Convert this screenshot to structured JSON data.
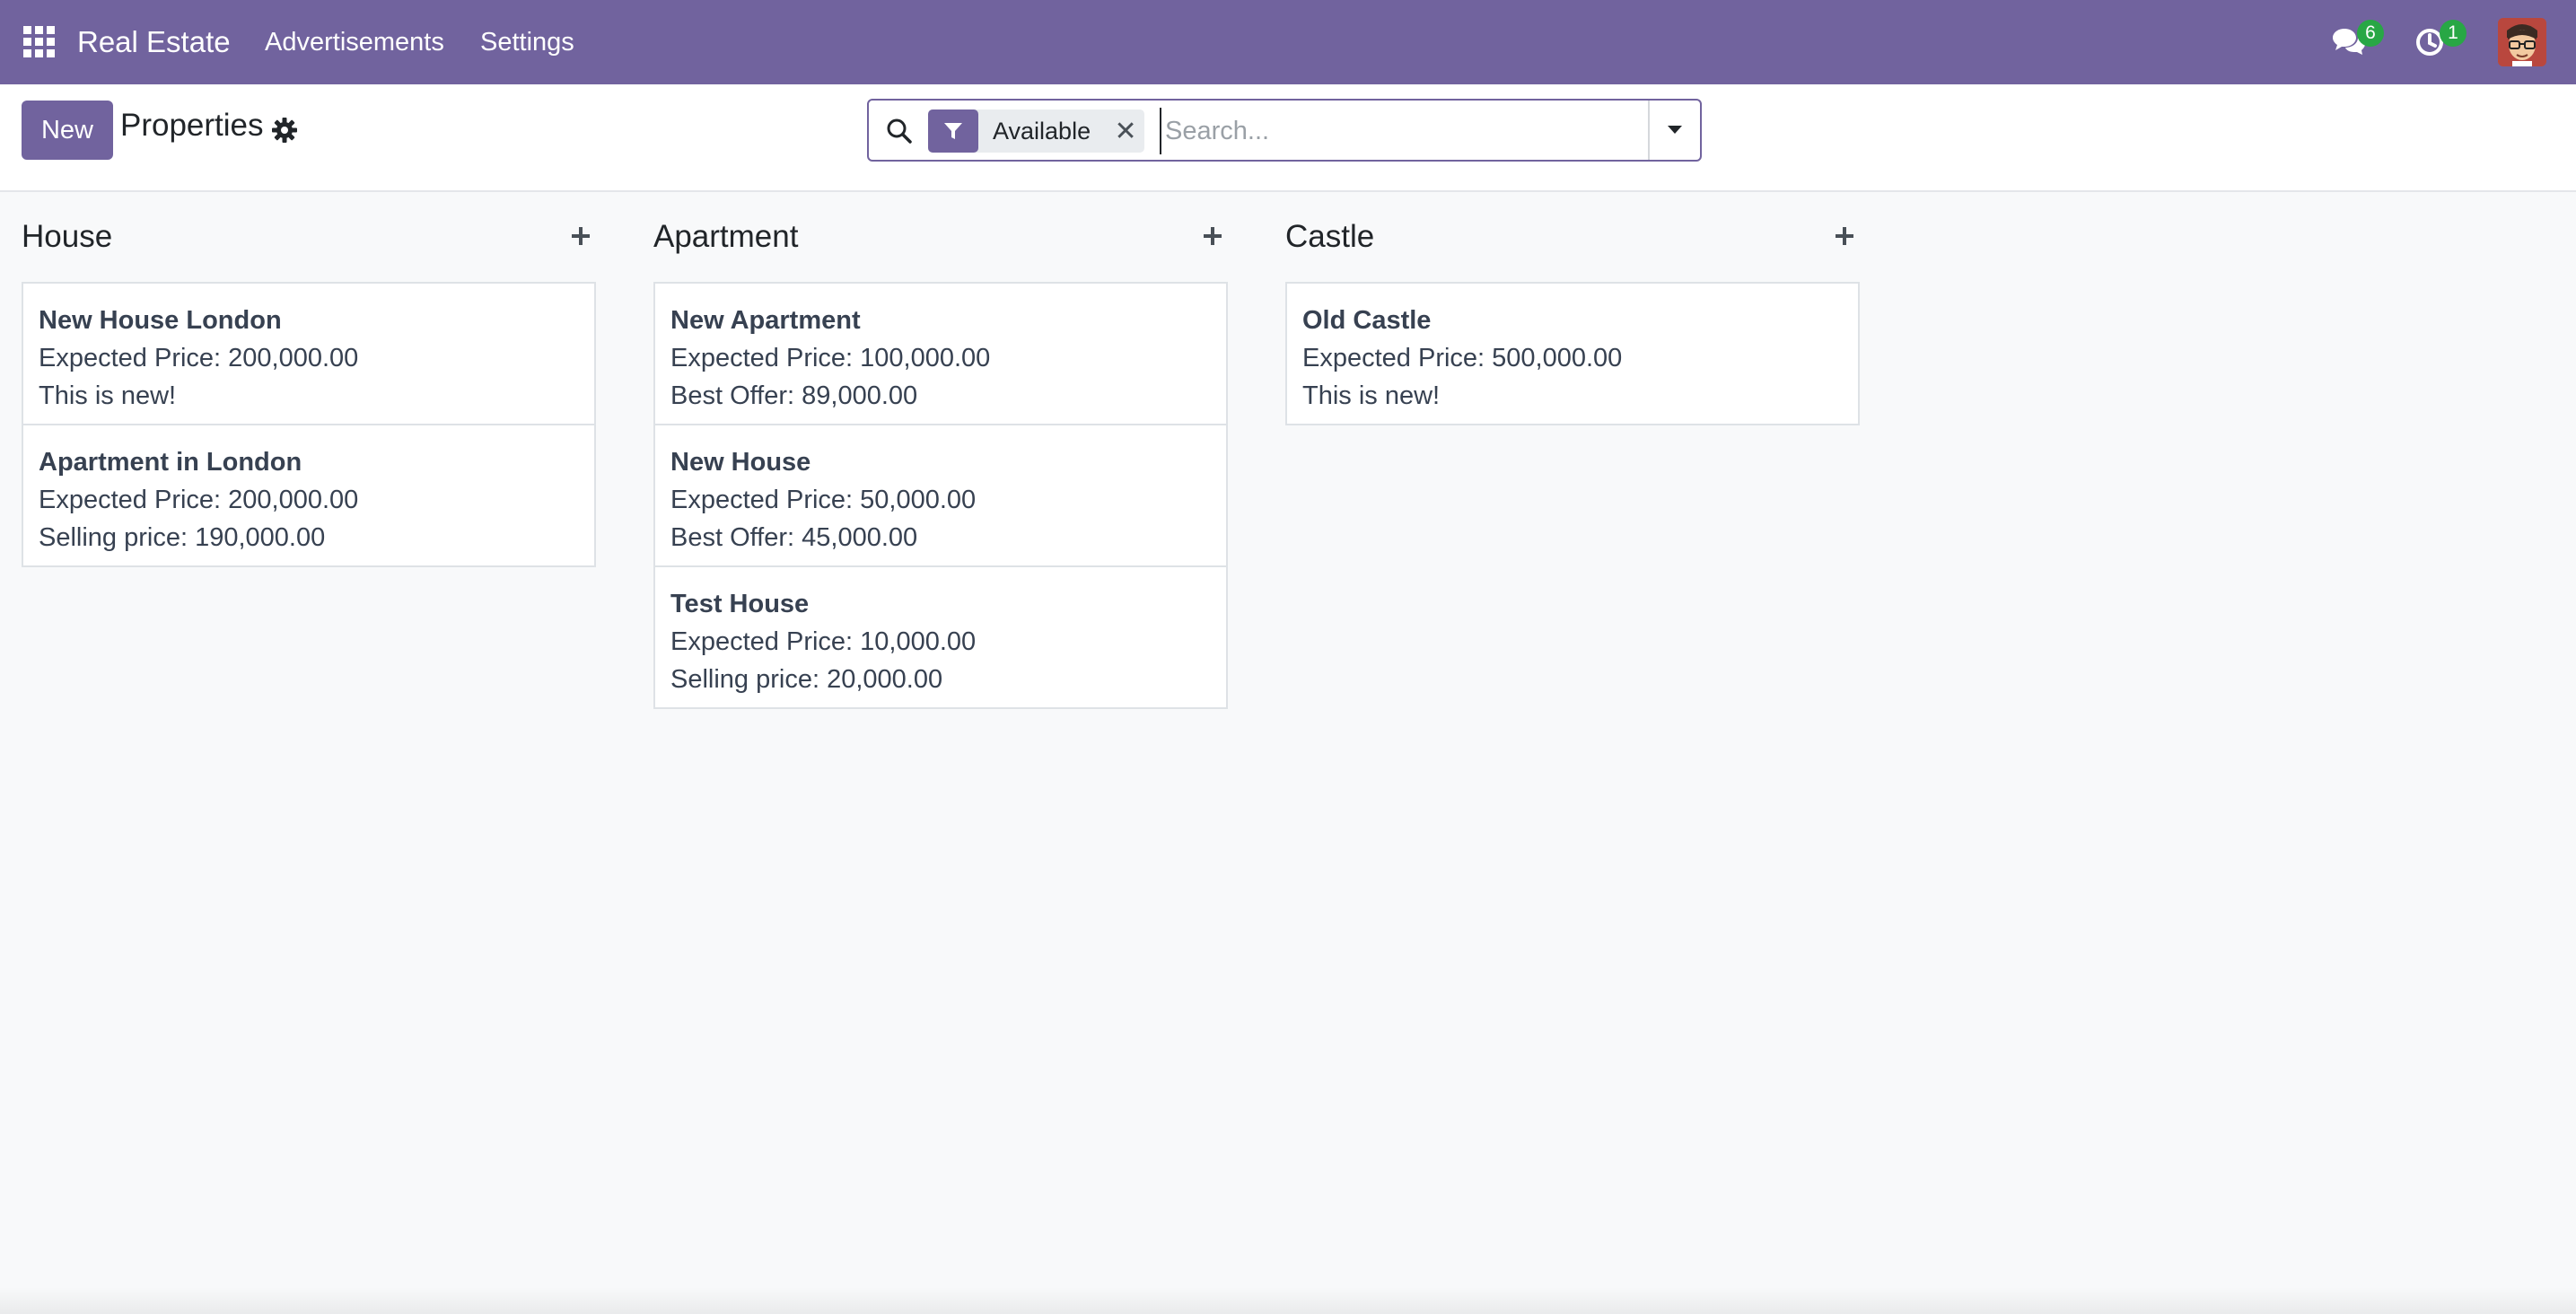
{
  "navbar": {
    "brand": "Real Estate",
    "menu": [
      {
        "label": "Advertisements"
      },
      {
        "label": "Settings"
      }
    ],
    "messages_count": "6",
    "activities_count": "1",
    "icons": [
      "apps-grid-icon",
      "chat-icon",
      "clock-icon",
      "user-avatar"
    ]
  },
  "control_panel": {
    "new_label": "New",
    "title": "Properties",
    "search": {
      "facet_label": "Available",
      "placeholder": "Search...",
      "value": ""
    }
  },
  "columns": [
    {
      "title": "House",
      "cards": [
        {
          "title": "New House London",
          "line1": "Expected Price: 200,000.00",
          "line2": "This is new!"
        },
        {
          "title": "Apartment in London",
          "line1": "Expected Price: 200,000.00",
          "line2": "Selling price: 190,000.00"
        }
      ]
    },
    {
      "title": "Apartment",
      "cards": [
        {
          "title": "New Apartment",
          "line1": "Expected Price: 100,000.00",
          "line2": "Best Offer: 89,000.00"
        },
        {
          "title": "New House",
          "line1": "Expected Price: 50,000.00",
          "line2": "Best Offer: 45,000.00"
        },
        {
          "title": "Test House",
          "line1": "Expected Price: 10,000.00",
          "line2": "Selling price: 20,000.00"
        }
      ]
    },
    {
      "title": "Castle",
      "cards": [
        {
          "title": "Old Castle",
          "line1": "Expected Price: 500,000.00",
          "line2": "This is new!"
        }
      ]
    }
  ],
  "colors": {
    "brand": "#71639e",
    "badge": "#28a745",
    "background": "#f8f9fa"
  }
}
